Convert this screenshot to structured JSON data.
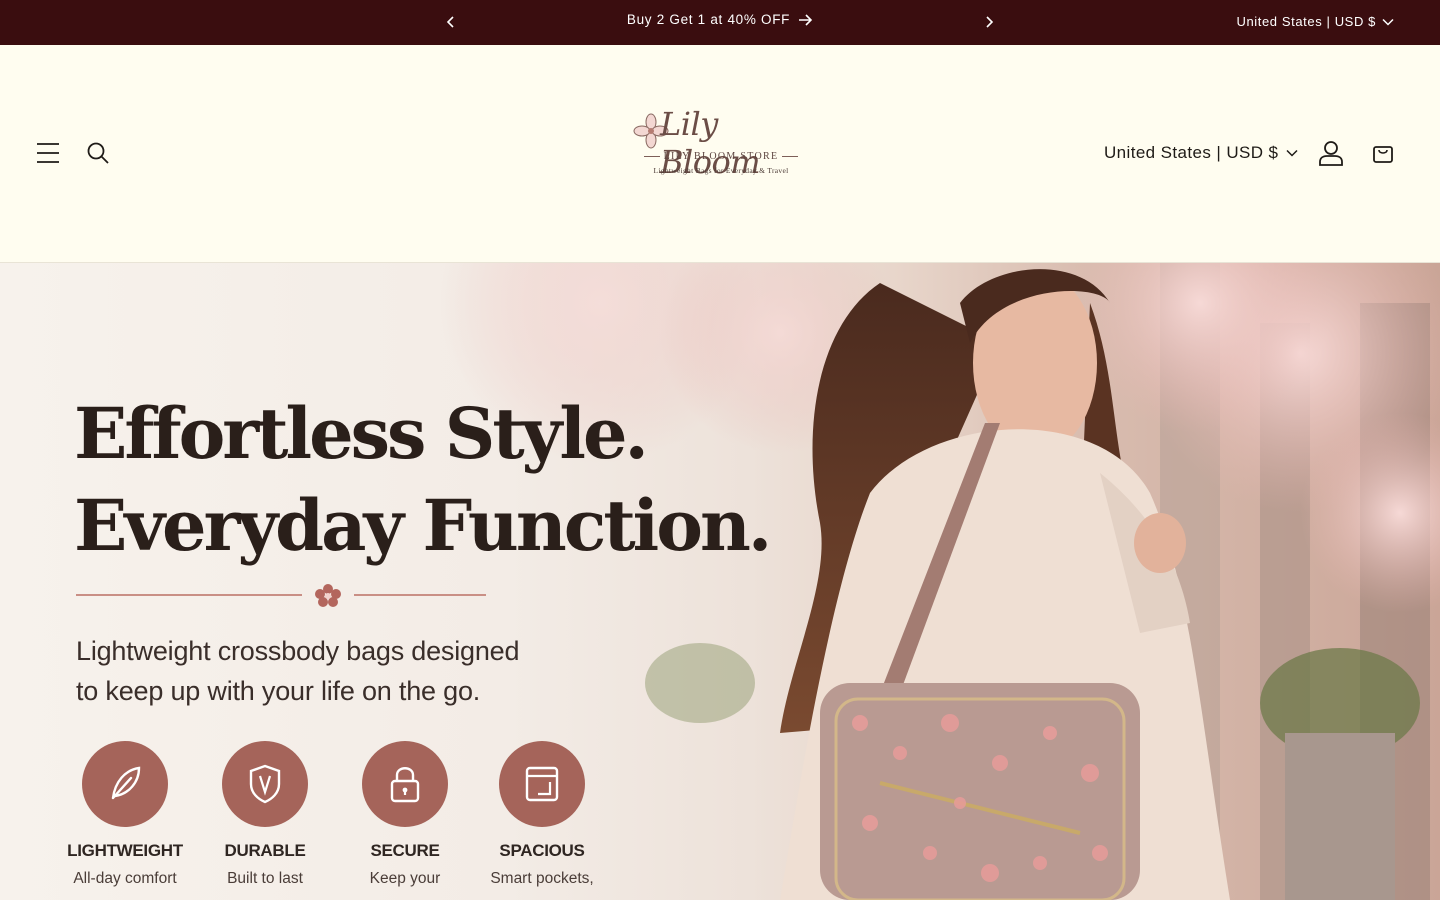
{
  "announcement": {
    "message": "Buy 2 Get 1 at 40% OFF",
    "locale": "United States | USD $"
  },
  "header": {
    "locale": "United States | USD $",
    "logo": {
      "script": "Lily Bloom",
      "store": "LILY BLOOM STORE",
      "tagline": "Lightweight Bags for Everyday & Travel"
    }
  },
  "hero": {
    "headline_line1": "Effortless Style.",
    "headline_line2": "Everyday Function.",
    "subtext_line1": "Lightweight crossbody bags designed",
    "subtext_line2": "to keep up with your life on the go.",
    "features": [
      {
        "title": "LIGHTWEIGHT",
        "subtitle": "All-day comfort",
        "icon": "feather-icon"
      },
      {
        "title": "DURABLE",
        "subtitle": "Built to last",
        "icon": "shield-icon"
      },
      {
        "title": "SECURE",
        "subtitle": "Keep your",
        "icon": "lock-icon"
      },
      {
        "title": "SPACIOUS",
        "subtitle": "Smart pockets,",
        "icon": "pocket-icon"
      }
    ]
  },
  "colors": {
    "announcement_bg": "#3a0d0f",
    "header_bg": "#fffdf0",
    "accent": "#a5645a"
  }
}
